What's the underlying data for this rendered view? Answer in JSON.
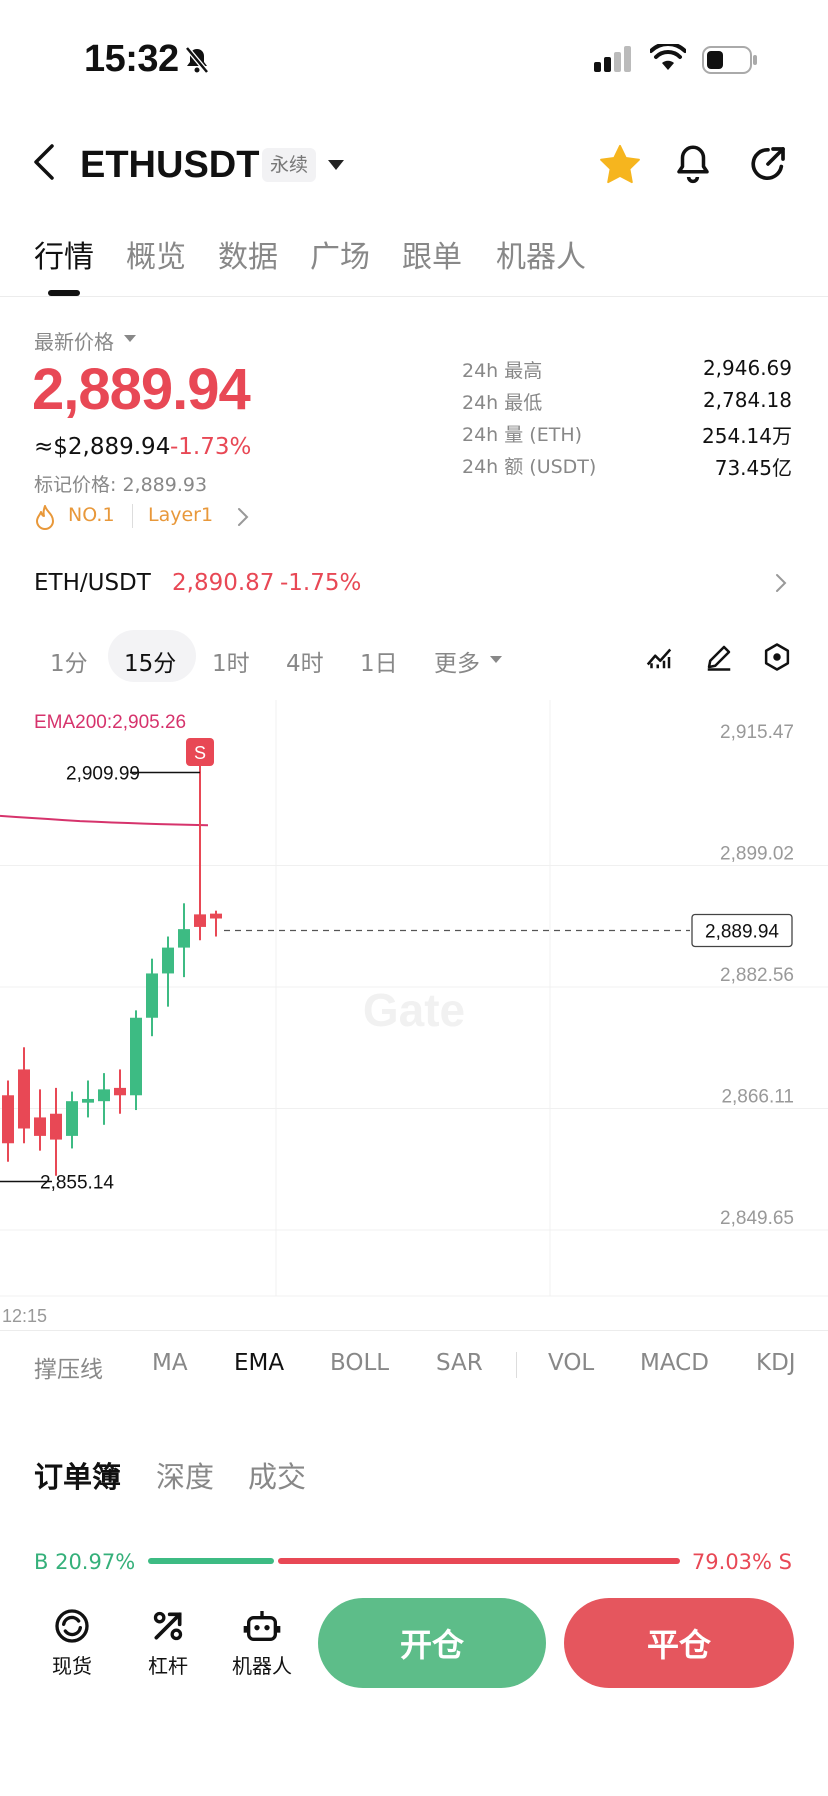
{
  "status_bar": {
    "time": "15:32"
  },
  "header": {
    "symbol": "ETHUSDT",
    "contract_type": "永续"
  },
  "tabs": [
    {
      "label": "行情"
    },
    {
      "label": "概览"
    },
    {
      "label": "数据"
    },
    {
      "label": "广场"
    },
    {
      "label": "跟单"
    },
    {
      "label": "机器人"
    }
  ],
  "price": {
    "latest_label": "最新价格",
    "last": "2,889.94",
    "usd": "≈$2,889.94",
    "change": "-1.73%",
    "mark_price": "标记价格: 2,889.93",
    "tag_rank": "NO.1",
    "tag_sector": "Layer1"
  },
  "stats": [
    {
      "label": "24h  最高",
      "value": "2,946.69"
    },
    {
      "label": "24h  最低",
      "value": "2,784.18"
    },
    {
      "label": "24h  量 (ETH)",
      "value": "254.14万"
    },
    {
      "label": "24h  额 (USDT)",
      "value": "73.45亿"
    }
  ],
  "pair_row": {
    "pair": "ETH/USDT",
    "price": "2,890.87",
    "change": "-1.75%"
  },
  "intervals": [
    {
      "label": "1分"
    },
    {
      "label": "15分"
    },
    {
      "label": "1时"
    },
    {
      "label": "4时"
    },
    {
      "label": "1日"
    },
    {
      "label": "更多"
    }
  ],
  "chart_data": {
    "type": "candlestick",
    "indicator_label": "EMA200:2,905.26",
    "y_ticks": [
      "2,915.47",
      "2,899.02",
      "2,882.56",
      "2,866.11",
      "2,849.65"
    ],
    "ylim": [
      2849.65,
      2915.47
    ],
    "current_price": "2,889.94",
    "high_label": "2,909.99",
    "low_label": "2,855.14",
    "x_tick": "12:15",
    "sell_marker": "S",
    "watermark": "Gate",
    "colors": {
      "up": "#3dbb83",
      "down": "#e84855",
      "ema": "#d6336c"
    },
    "candles": [
      {
        "o": 2866.0,
        "h": 2868.0,
        "l": 2857.0,
        "c": 2859.5
      },
      {
        "o": 2869.5,
        "h": 2872.5,
        "l": 2859.5,
        "c": 2861.5
      },
      {
        "o": 2863.0,
        "h": 2866.8,
        "l": 2858.5,
        "c": 2860.5
      },
      {
        "o": 2863.5,
        "h": 2867.0,
        "l": 2855.1,
        "c": 2860.0
      },
      {
        "o": 2860.5,
        "h": 2866.5,
        "l": 2858.8,
        "c": 2865.2
      },
      {
        "o": 2865.0,
        "h": 2868.0,
        "l": 2863.0,
        "c": 2865.5
      },
      {
        "o": 2865.2,
        "h": 2869.0,
        "l": 2862.0,
        "c": 2866.8
      },
      {
        "o": 2867.0,
        "h": 2869.5,
        "l": 2863.5,
        "c": 2866.0
      },
      {
        "o": 2866.0,
        "h": 2877.5,
        "l": 2864.0,
        "c": 2876.5
      },
      {
        "o": 2876.5,
        "h": 2884.5,
        "l": 2874.0,
        "c": 2882.5
      },
      {
        "o": 2882.5,
        "h": 2887.5,
        "l": 2878.0,
        "c": 2886.0
      },
      {
        "o": 2886.0,
        "h": 2892.0,
        "l": 2882.0,
        "c": 2888.5
      },
      {
        "o": 2890.5,
        "h": 2909.99,
        "l": 2887.0,
        "c": 2888.8
      },
      {
        "o": 2890.6,
        "h": 2891.0,
        "l": 2887.5,
        "c": 2889.94
      }
    ],
    "ema": [
      2906.0,
      2905.9,
      2905.8,
      2905.7,
      2905.6,
      2905.5,
      2905.45,
      2905.4,
      2905.36,
      2905.33,
      2905.3,
      2905.28,
      2905.27,
      2905.26
    ]
  },
  "indicators": [
    {
      "label": "撑压线"
    },
    {
      "label": "MA"
    },
    {
      "label": "EMA"
    },
    {
      "label": "BOLL"
    },
    {
      "label": "SAR"
    },
    {
      "label": "VOL"
    },
    {
      "label": "MACD"
    },
    {
      "label": "KDJ"
    }
  ],
  "orderbook": {
    "tabs": [
      {
        "label": "订单簿"
      },
      {
        "label": "深度"
      },
      {
        "label": "成交"
      }
    ],
    "buy_ratio": "B 20.97%",
    "sell_ratio": "79.03% S"
  },
  "bottom_nav": [
    {
      "label": "现货",
      "icon": "spot-icon"
    },
    {
      "label": "杠杆",
      "icon": "margin-icon"
    },
    {
      "label": "机器人",
      "icon": "robot-icon"
    }
  ],
  "actions": {
    "open": "开仓",
    "close": "平仓"
  }
}
